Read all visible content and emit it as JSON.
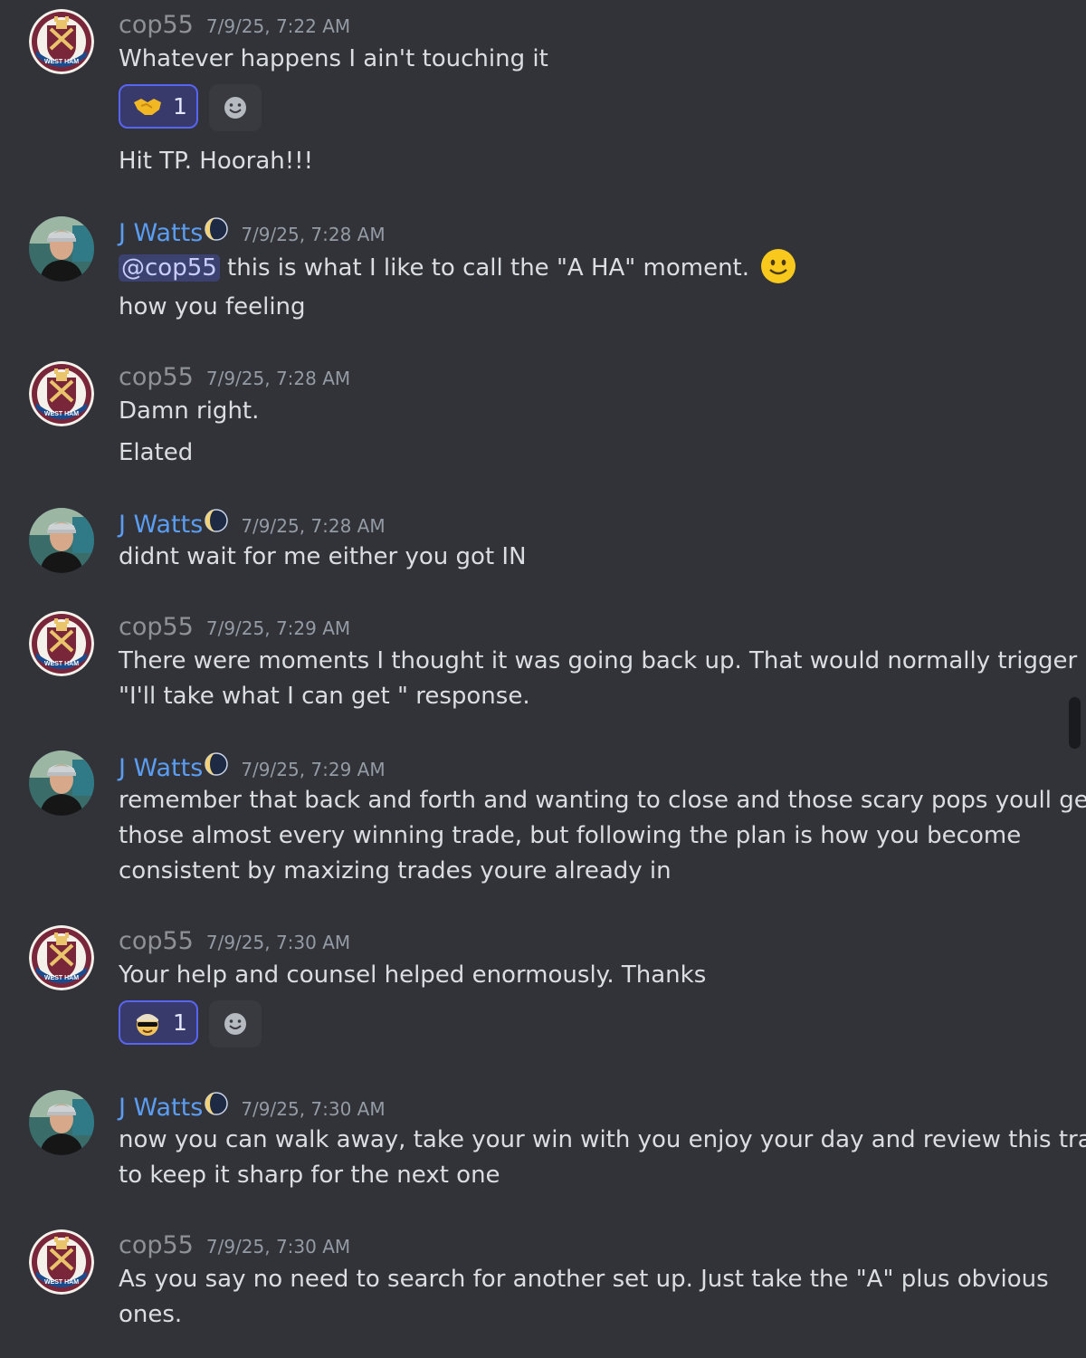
{
  "users": {
    "cop55": "cop55",
    "jwatts": "J Watts"
  },
  "messages": [
    {
      "user": "cop55",
      "timestamp": "7/9/25, 7:22 AM",
      "lines": [
        "Whatever happens I ain't touching it"
      ],
      "reaction": {
        "emoji": "handshake",
        "count": "1"
      },
      "extra_lines": [
        "Hit TP. Hoorah!!!"
      ]
    },
    {
      "user": "J Watts",
      "timestamp": "7/9/25, 7:28 AM",
      "mention": "@cop55",
      "lines": [
        " this is what I like to call the \"A HA\" moment.",
        "how you feeling"
      ]
    },
    {
      "user": "cop55",
      "timestamp": "7/9/25, 7:28 AM",
      "lines": [
        "Damn right.",
        "Elated"
      ]
    },
    {
      "user": "J Watts",
      "timestamp": "7/9/25, 7:28 AM",
      "lines": [
        "didnt wait for me either you got IN"
      ]
    },
    {
      "user": "cop55",
      "timestamp": "7/9/25, 7:29 AM",
      "lines": [
        "There were moments I thought it was going back up. That would normally trigger a",
        "\"I'll take what I can get \" response."
      ]
    },
    {
      "user": "J Watts",
      "timestamp": "7/9/25, 7:29 AM",
      "lines": [
        "remember that back and forth and wanting to close and those scary pops youll get",
        "those almost every winning trade, but following the plan is how you become",
        "consistent by maxizing trades youre already in"
      ]
    },
    {
      "user": "cop55",
      "timestamp": "7/9/25, 7:30 AM",
      "lines": [
        "Your help and counsel helped enormously. Thanks"
      ],
      "reaction": {
        "emoji": "cool-face",
        "count": "1"
      }
    },
    {
      "user": "J Watts",
      "timestamp": "7/9/25, 7:30 AM",
      "lines": [
        "now you can walk away, take your win with you enjoy your day and review this trade",
        "to keep it sharp for the next one"
      ]
    },
    {
      "user": "cop55",
      "timestamp": "7/9/25, 7:30 AM",
      "lines": [
        "As you say no need to search for another set up. Just take the \"A\" plus obvious",
        "ones."
      ]
    }
  ],
  "colors": {
    "background": "#313338",
    "jwatts_name": "#5b9df2",
    "cop55_name": "#8e9297",
    "reaction_border": "#5865f2"
  }
}
